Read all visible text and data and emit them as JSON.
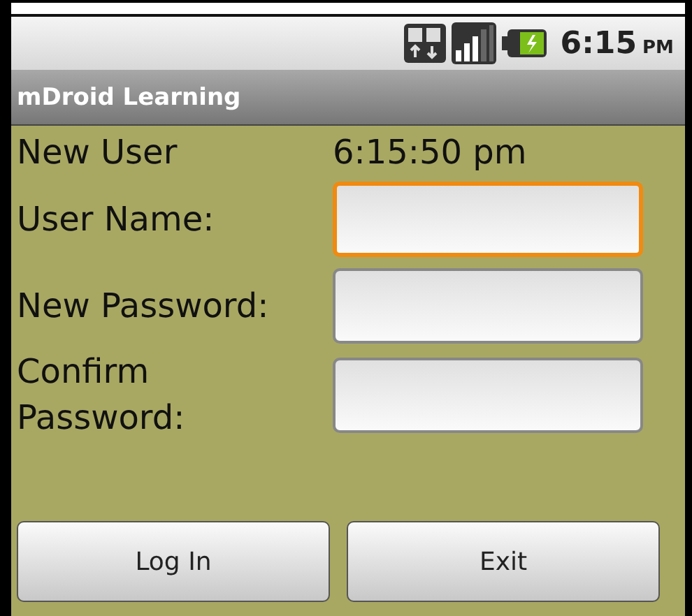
{
  "status_bar": {
    "time": "6:15",
    "period": "PM"
  },
  "window": {
    "title": "mDroid Learning"
  },
  "header": {
    "label": "New User",
    "time": "6:15:50 pm"
  },
  "fields": [
    {
      "label": "User Name:",
      "focused": true
    },
    {
      "label": "New Password:",
      "focused": false
    },
    {
      "label": "Confirm Password:",
      "focused": false
    }
  ],
  "buttons": [
    "Log In",
    "Exit"
  ]
}
